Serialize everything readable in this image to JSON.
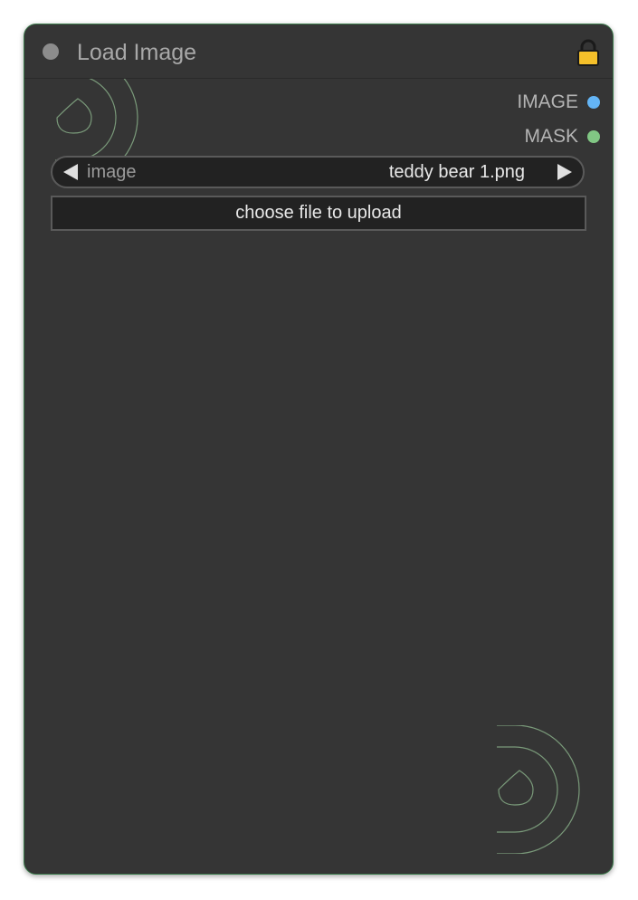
{
  "node": {
    "title": "Load Image",
    "outputs": [
      {
        "label": "IMAGE",
        "color": "#64b5f6"
      },
      {
        "label": "MASK",
        "color": "#81c784"
      }
    ],
    "image_widget": {
      "name": "image",
      "value": "teddy bear 1.png"
    },
    "upload_button_label": "choose file to upload"
  },
  "colors": {
    "node_bg": "#353535",
    "node_border": "#3e7d4e",
    "lock": "#f5c02a",
    "widget_bg": "#222222"
  },
  "icons": [
    "collapse-dot-icon",
    "lock-icon",
    "left-arrow-icon",
    "right-arrow-icon"
  ]
}
